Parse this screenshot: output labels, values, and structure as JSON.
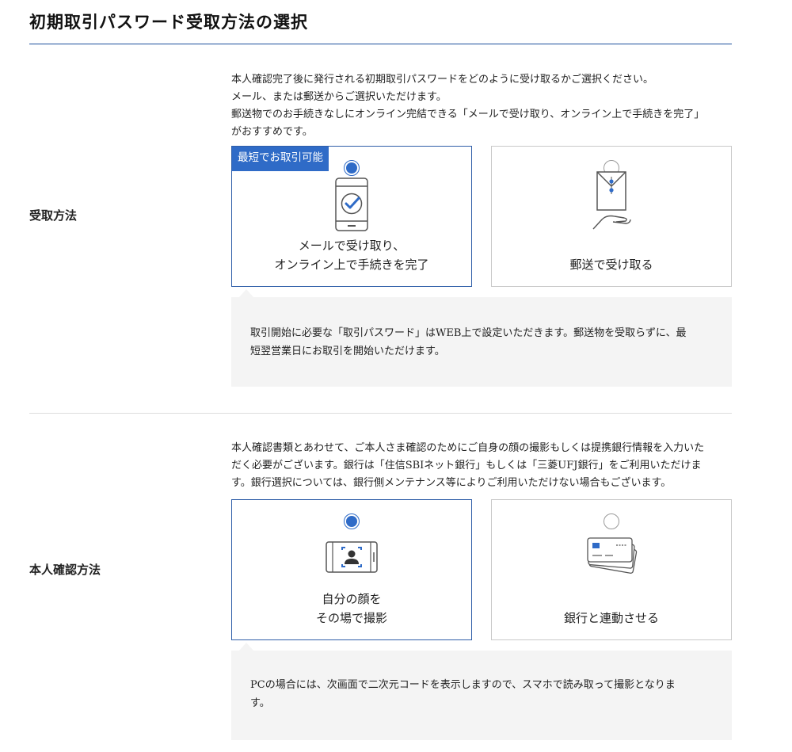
{
  "page": {
    "title": "初期取引パスワード受取方法の選択"
  },
  "receipt": {
    "row_label": "受取方法",
    "intro": [
      "本人確認完了後に発行される初期取引パスワードをどのように受け取るかご選択ください。",
      "メール、または郵送からご選択いただけます。",
      "郵送物でのお手続きなしにオンライン完結できる「メールで受け取り、オンライン上で手続きを完了」",
      "がおすすめです。"
    ],
    "options": [
      {
        "badge": "最短でお取引可能",
        "label_lines": [
          "メールで受け取り、",
          "オンライン上で手続きを完了"
        ],
        "selected": true,
        "icon": "smartphone-check-icon"
      },
      {
        "label_lines": [
          "郵送で受け取る"
        ],
        "selected": false,
        "icon": "envelope-hand-icon"
      }
    ],
    "note": [
      "取引開始に必要な「取引パスワード」はWEB上で設定いただきます。郵送物を受取らずに、最",
      "短翌営業日にお取引を開始いただけます。"
    ]
  },
  "identity": {
    "row_label": "本人確認方法",
    "intro": [
      "本人確認書類とあわせて、ご本人さま確認のためにご自身の顔の撮影もしくは提携銀行情報を入力いた",
      "だく必要がございます。銀行は「住信SBIネット銀行」もしくは「三菱UFJ銀行」をご利用いただけま",
      "す。銀行選択については、銀行側メンテナンス等によりご利用いただけない場合もございます。"
    ],
    "options": [
      {
        "label_lines": [
          "自分の顔を",
          "その場で撮影"
        ],
        "selected": true,
        "icon": "face-camera-icon"
      },
      {
        "label_lines": [
          "銀行と連動させる"
        ],
        "selected": false,
        "icon": "bank-cards-icon"
      }
    ],
    "note": [
      "PCの場合には、次画面で二次元コードを表示しますので、スマホで読み取って撮影となりま",
      "す。"
    ]
  },
  "colors": {
    "accent": "#2f6bc7",
    "selected_border": "#2f5ea8",
    "note_background": "#f4f4f4"
  }
}
